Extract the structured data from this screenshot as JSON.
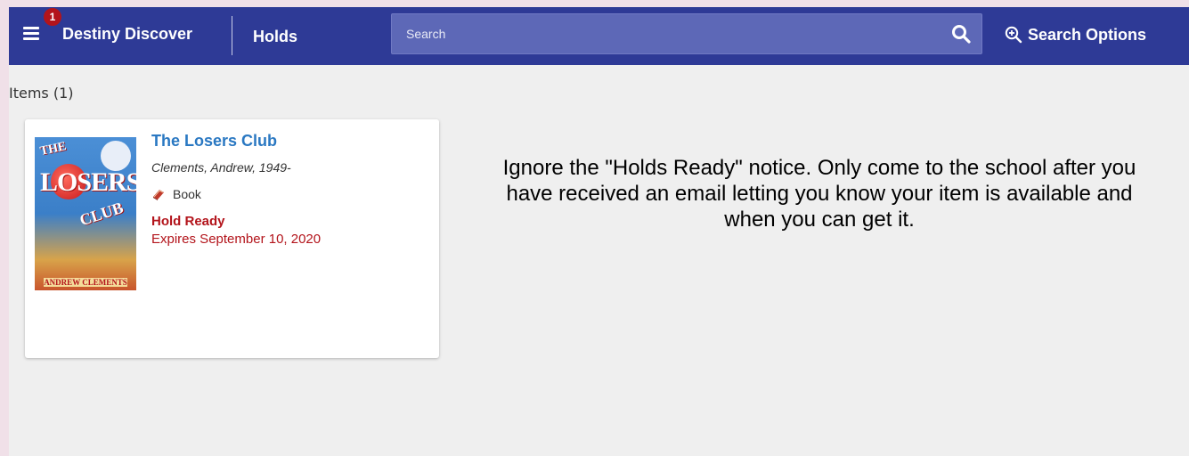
{
  "header": {
    "notification_count": "1",
    "brand": "Destiny Discover",
    "section": "Holds",
    "search": {
      "placeholder": "Search",
      "value": ""
    },
    "search_options_label": "Search Options"
  },
  "items": {
    "heading": "Items",
    "count": "(1)",
    "list": [
      {
        "cover_text": {
          "the": "THE",
          "main": "LOSERS",
          "club": "CLUB",
          "author": "ANDREW CLEMENTS"
        },
        "title": "The Losers Club",
        "author": "Clements, Andrew, 1949-",
        "format_icon": "book-icon",
        "format": "Book",
        "status": "Hold Ready",
        "expires": "Expires September 10, 2020"
      }
    ]
  },
  "notice": "Ignore the \"Holds Ready\" notice.  Only come to the school after you have received an email letting you know your item is available and when you can get it.",
  "colors": {
    "header_bg": "#2e3a96",
    "search_bg": "#5d68b7",
    "link": "#2a78c2",
    "status_red": "#b3141b",
    "page_bg": "#efefef",
    "outer_bg": "#f0e0e8"
  }
}
